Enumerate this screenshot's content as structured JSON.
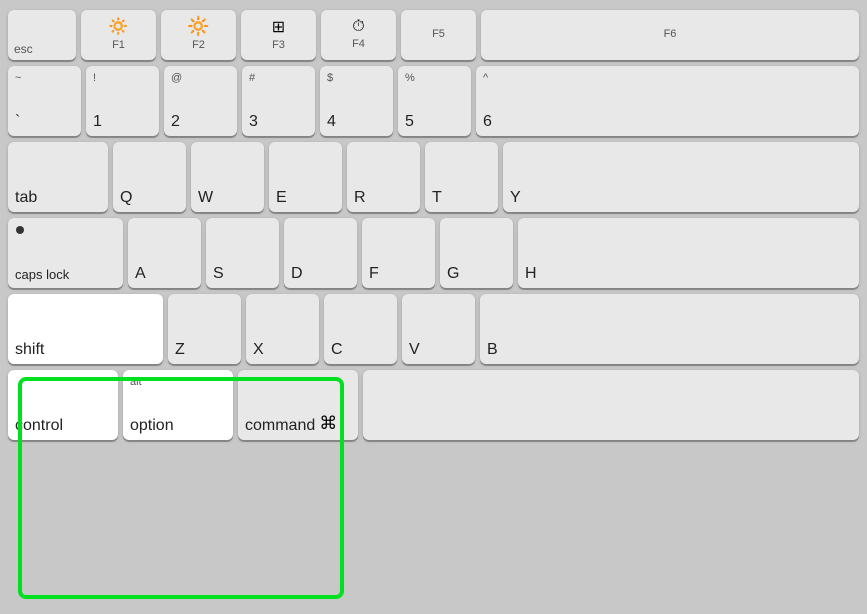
{
  "keyboard": {
    "background_color": "#c8c8c8",
    "key_color": "#e8e8e8",
    "highlight_color": "#ffffff",
    "highlight_border": "#00e020",
    "rows": {
      "fn_row": {
        "keys": [
          {
            "id": "esc",
            "label": "esc",
            "type": "special"
          },
          {
            "id": "f1",
            "symbol": "☀",
            "sublabel": "F1"
          },
          {
            "id": "f2",
            "symbol": "☀",
            "sublabel": "F2"
          },
          {
            "id": "f3",
            "symbol": "⊞",
            "sublabel": "F3"
          },
          {
            "id": "f4",
            "symbol": "⏱",
            "sublabel": "F4"
          },
          {
            "id": "f5",
            "sublabel": "F5"
          },
          {
            "id": "f6",
            "sublabel": "F6"
          }
        ]
      },
      "number_row": {
        "keys": [
          {
            "id": "tilde",
            "top": "~",
            "bottom": "`"
          },
          {
            "id": "1",
            "top": "!",
            "bottom": "1"
          },
          {
            "id": "2",
            "top": "@",
            "bottom": "2"
          },
          {
            "id": "3",
            "top": "#",
            "bottom": "3"
          },
          {
            "id": "4",
            "top": "$",
            "bottom": "4"
          },
          {
            "id": "5",
            "top": "%",
            "bottom": "5"
          },
          {
            "id": "6",
            "top": "^",
            "bottom": "6"
          }
        ]
      },
      "qwerty_row": {
        "keys": [
          {
            "id": "tab",
            "label": "tab",
            "type": "wide"
          },
          {
            "id": "q",
            "label": "Q"
          },
          {
            "id": "w",
            "label": "W"
          },
          {
            "id": "e",
            "label": "E"
          },
          {
            "id": "r",
            "label": "R"
          },
          {
            "id": "t",
            "label": "T"
          },
          {
            "id": "y",
            "label": "Y"
          }
        ]
      },
      "asdf_row": {
        "keys": [
          {
            "id": "caps",
            "label": "caps lock",
            "type": "wide"
          },
          {
            "id": "a",
            "label": "A"
          },
          {
            "id": "s",
            "label": "S"
          },
          {
            "id": "d",
            "label": "D"
          },
          {
            "id": "f",
            "label": "F"
          },
          {
            "id": "g",
            "label": "G"
          },
          {
            "id": "h",
            "label": "H"
          }
        ]
      },
      "zxcv_row": {
        "keys": [
          {
            "id": "shift_left",
            "label": "shift",
            "type": "wide",
            "highlighted": true
          },
          {
            "id": "z",
            "label": "Z"
          },
          {
            "id": "x",
            "label": "X"
          },
          {
            "id": "c",
            "label": "C"
          },
          {
            "id": "v",
            "label": "V"
          },
          {
            "id": "b",
            "label": "B"
          }
        ]
      },
      "bottom_row": {
        "keys": [
          {
            "id": "control",
            "label": "control",
            "highlighted": true
          },
          {
            "id": "alt",
            "top_label": "alt",
            "label": "option",
            "highlighted": true
          },
          {
            "id": "command",
            "label": "command",
            "symbol": "⌘"
          }
        ]
      }
    }
  }
}
